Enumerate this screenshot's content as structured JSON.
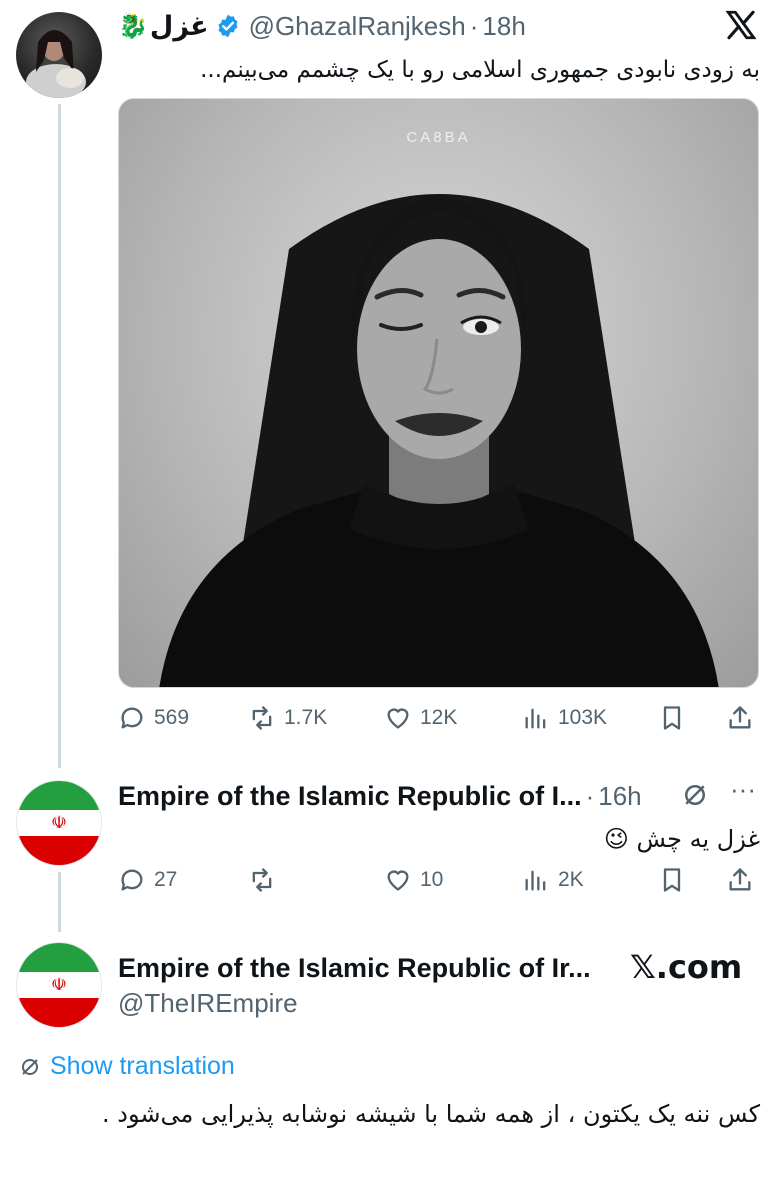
{
  "post1": {
    "display_name": "غزل",
    "name_emoji": "🐉",
    "handle": "@GhazalRanjkesh",
    "time": "18h",
    "text": "به زودی نابودی جمهوری اسلامی رو با یک چشمم می‌بینم...",
    "image_watermark": "CA8BA",
    "stats": {
      "replies": "569",
      "reposts": "1.7K",
      "likes": "12K",
      "views": "103K"
    }
  },
  "reply1": {
    "display_name": "Empire of the Islamic Republic of I...",
    "time": "16h",
    "text": "غزل یه چش 😉",
    "stats": {
      "replies": "27",
      "reposts": "",
      "likes": "10",
      "views": "2K"
    }
  },
  "quote_card": {
    "display_name": "Empire of the Islamic Republic of Ir...",
    "handle": "@TheIREmpire",
    "site": "𝕏.com",
    "translation_label": "Show translation",
    "text": "کس ننه یک یکتون ، از همه شما با شیشه نوشابه پذیرایی می‌شود ."
  },
  "icons": {
    "x_logo": "x-logo-icon",
    "verified": "verified-badge-icon",
    "reply": "reply-icon",
    "repost": "repost-icon",
    "like": "heart-icon",
    "views": "views-icon",
    "bookmark": "bookmark-icon",
    "share": "share-icon",
    "more": "more-icon",
    "translate": "translate-icon"
  },
  "colors": {
    "verified_blue": "#1d9bf0",
    "link_blue": "#1d9bf0",
    "muted_gray": "#536471",
    "flag_green": "#239f40",
    "flag_red": "#da0000"
  }
}
